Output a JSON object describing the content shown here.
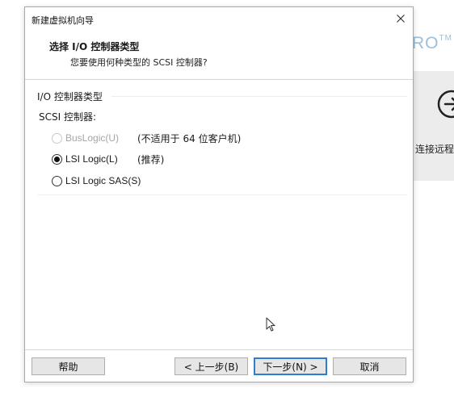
{
  "background": {
    "logo_text": "RO",
    "logo_tm": "TM",
    "panel_label": "连接远程"
  },
  "dialog": {
    "title": "新建虚拟机向导",
    "close_glyph": "×",
    "header": {
      "title": "选择 I/O 控制器类型",
      "subtitle": "您要使用何种类型的 SCSI 控制器?"
    },
    "group": {
      "title": "I/O 控制器类型",
      "scsi_label": "SCSI 控制器:",
      "options": [
        {
          "label": "BusLogic(U)",
          "note": "(不适用于 64 位客户机)",
          "checked": false,
          "disabled": true
        },
        {
          "label": "LSI Logic(L)",
          "note": "(推荐)",
          "checked": true,
          "disabled": false
        },
        {
          "label": "LSI Logic SAS(S)",
          "note": "",
          "checked": false,
          "disabled": false
        }
      ]
    },
    "buttons": {
      "help": "帮助",
      "back": "< 上一步(B)",
      "next": "下一步(N) >",
      "cancel": "取消"
    }
  }
}
